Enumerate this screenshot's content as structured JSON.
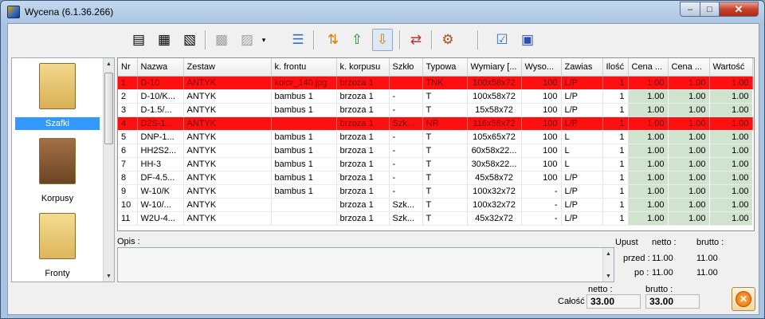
{
  "window": {
    "title": "Wycena (6.1.36.266)",
    "minimize": "–",
    "maximize": "□",
    "close": "✕"
  },
  "categories": [
    {
      "label": "Szafki"
    },
    {
      "label": "Korpusy"
    },
    {
      "label": "Fronty"
    }
  ],
  "table": {
    "columns": [
      "Nr",
      "Nazwa",
      "Zestaw",
      "k. frontu",
      "k. korpusu",
      "Szkło",
      "Typowa",
      "Wymiary [...",
      "Wyso...",
      "Zawias",
      "Ilość",
      "Cena ...",
      "Cena ...",
      "Wartość"
    ],
    "rows": [
      {
        "nr": "1",
        "nazwa": "D-10",
        "zestaw": "ANTYK",
        "kfrontu": "kolor_140.jpg",
        "kkorpusu": "brzoza 1",
        "szklo": "",
        "typowa": "TNK",
        "wymiary": "100x58x72",
        "wys": "100",
        "zawias": "L/P",
        "ilosc": "1",
        "cena1": "1.00",
        "cena2": "1.00",
        "wartosc": "1.00",
        "error": true
      },
      {
        "nr": "2",
        "nazwa": "D-10/K...",
        "zestaw": "ANTYK",
        "kfrontu": "bambus 1",
        "kkorpusu": "brzoza 1",
        "szklo": "-",
        "typowa": "T",
        "wymiary": "100x58x72",
        "wys": "100",
        "zawias": "L/P",
        "ilosc": "1",
        "cena1": "1.00",
        "cena2": "1.00",
        "wartosc": "1.00",
        "error": false
      },
      {
        "nr": "3",
        "nazwa": "D-1.5/...",
        "zestaw": "ANTYK",
        "kfrontu": "bambus 1",
        "kkorpusu": "brzoza 1",
        "szklo": "-",
        "typowa": "T",
        "wymiary": "15x58x72",
        "wys": "100",
        "zawias": "L/P",
        "ilosc": "1",
        "cena1": "1.00",
        "cena2": "1.00",
        "wartosc": "1.00",
        "error": false
      },
      {
        "nr": "4",
        "nazwa": "D2S-1...",
        "zestaw": "ANTYK",
        "kfrontu": "",
        "kkorpusu": "brzoza 1",
        "szklo": "Szk...",
        "typowa": "NR",
        "wymiary": "116x58x72",
        "wys": "100",
        "zawias": "L/P",
        "ilosc": "1",
        "cena1": "1.00",
        "cena2": "1.00",
        "wartosc": "1.00",
        "error": true
      },
      {
        "nr": "5",
        "nazwa": "DNP-1...",
        "zestaw": "ANTYK",
        "kfrontu": "bambus 1",
        "kkorpusu": "brzoza 1",
        "szklo": "-",
        "typowa": "T",
        "wymiary": "105x65x72",
        "wys": "100",
        "zawias": "L",
        "ilosc": "1",
        "cena1": "1.00",
        "cena2": "1.00",
        "wartosc": "1.00",
        "error": false
      },
      {
        "nr": "6",
        "nazwa": "HH2S2...",
        "zestaw": "ANTYK",
        "kfrontu": "bambus 1",
        "kkorpusu": "brzoza 1",
        "szklo": "-",
        "typowa": "T",
        "wymiary": "60x58x22...",
        "wys": "100",
        "zawias": "L",
        "ilosc": "1",
        "cena1": "1.00",
        "cena2": "1.00",
        "wartosc": "1.00",
        "error": false
      },
      {
        "nr": "7",
        "nazwa": "HH-3",
        "zestaw": "ANTYK",
        "kfrontu": "bambus 1",
        "kkorpusu": "brzoza 1",
        "szklo": "-",
        "typowa": "T",
        "wymiary": "30x58x22...",
        "wys": "100",
        "zawias": "L",
        "ilosc": "1",
        "cena1": "1.00",
        "cena2": "1.00",
        "wartosc": "1.00",
        "error": false
      },
      {
        "nr": "8",
        "nazwa": "DF-4.5...",
        "zestaw": "ANTYK",
        "kfrontu": "bambus 1",
        "kkorpusu": "brzoza 1",
        "szklo": "-",
        "typowa": "T",
        "wymiary": "45x58x72",
        "wys": "100",
        "zawias": "L/P",
        "ilosc": "1",
        "cena1": "1.00",
        "cena2": "1.00",
        "wartosc": "1.00",
        "error": false
      },
      {
        "nr": "9",
        "nazwa": "W-10/K",
        "zestaw": "ANTYK",
        "kfrontu": "bambus 1",
        "kkorpusu": "brzoza 1",
        "szklo": "-",
        "typowa": "T",
        "wymiary": "100x32x72",
        "wys": "-",
        "zawias": "L/P",
        "ilosc": "1",
        "cena1": "1.00",
        "cena2": "1.00",
        "wartosc": "1.00",
        "error": false
      },
      {
        "nr": "10",
        "nazwa": "W-10/...",
        "zestaw": "ANTYK",
        "kfrontu": "",
        "kkorpusu": "brzoza 1",
        "szklo": "Szk...",
        "typowa": "T",
        "wymiary": "100x32x72",
        "wys": "-",
        "zawias": "L/P",
        "ilosc": "1",
        "cena1": "1.00",
        "cena2": "1.00",
        "wartosc": "1.00",
        "error": false
      },
      {
        "nr": "11",
        "nazwa": "W2U-4...",
        "zestaw": "ANTYK",
        "kfrontu": "",
        "kkorpusu": "brzoza 1",
        "szklo": "Szk...",
        "typowa": "T",
        "wymiary": "45x32x72",
        "wys": "-",
        "zawias": "L/P",
        "ilosc": "1",
        "cena1": "1.00",
        "cena2": "1.00",
        "wartosc": "1.00",
        "error": false
      }
    ]
  },
  "opis": {
    "label": "Opis :",
    "value": ""
  },
  "summary": {
    "upust": "Upust",
    "netto_h": "netto :",
    "brutto_h": "brutto :",
    "przed_label": "przed :",
    "przed_netto": "11.00",
    "przed_brutto": "11.00",
    "po_label": "po :",
    "po_netto": "11.00",
    "po_brutto": "11.00"
  },
  "totals": {
    "label": "Całość :",
    "netto_h": "netto :",
    "brutto_h": "brutto :",
    "netto": "33.00",
    "brutto": "33.00"
  },
  "colors": {
    "error_row": "#ff1010",
    "price_cell": "#cfe3cf",
    "selection": "#3399ff"
  }
}
